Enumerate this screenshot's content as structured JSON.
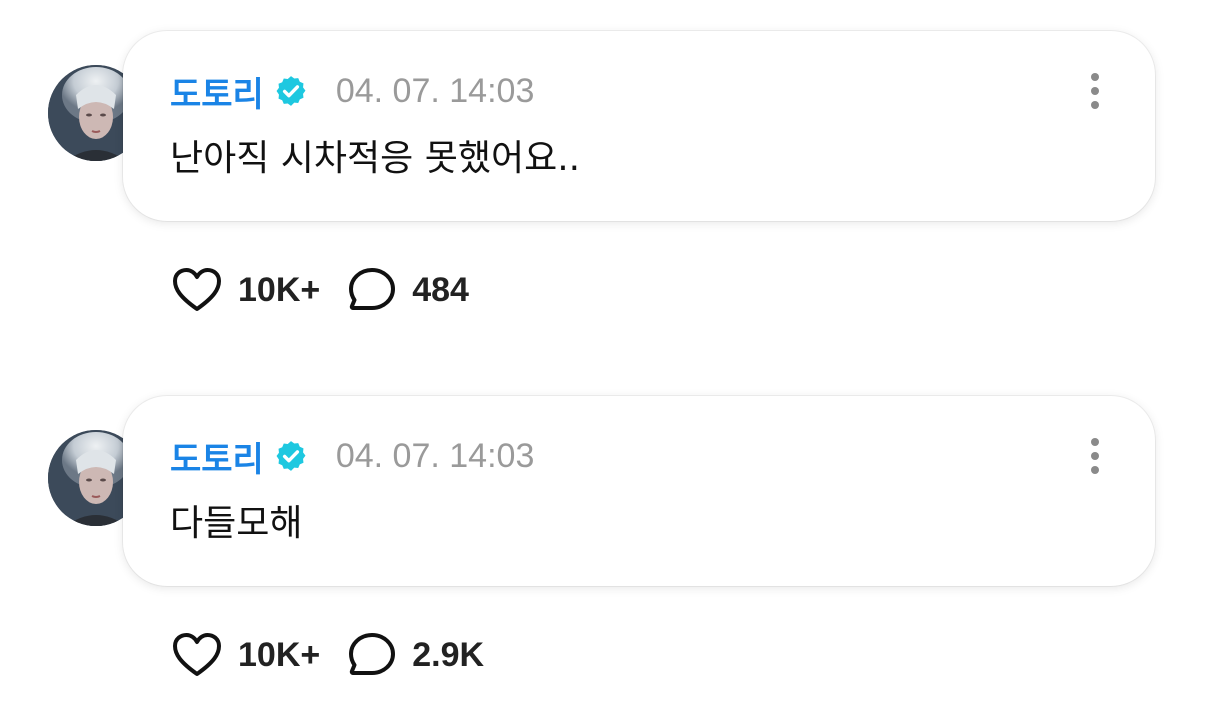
{
  "comments": [
    {
      "author": "도토리",
      "verified_icon": "verified-badge-icon",
      "timestamp": "04. 07. 14:03",
      "message": "난아직 시차적응 못했어요..",
      "likes": "10K+",
      "replies": "484"
    },
    {
      "author": "도토리",
      "verified_icon": "verified-badge-icon",
      "timestamp": "04. 07. 14:03",
      "message": "다들모해",
      "likes": "10K+",
      "replies": "2.9K"
    }
  ],
  "colors": {
    "author": "#1a84e6",
    "verified_badge": "#1ec8e0",
    "timestamp": "#9a9a9a",
    "text": "#111111"
  },
  "icons": {
    "like": "heart-outline-icon",
    "reply": "speech-bubble-icon",
    "more": "more-vertical-icon"
  }
}
